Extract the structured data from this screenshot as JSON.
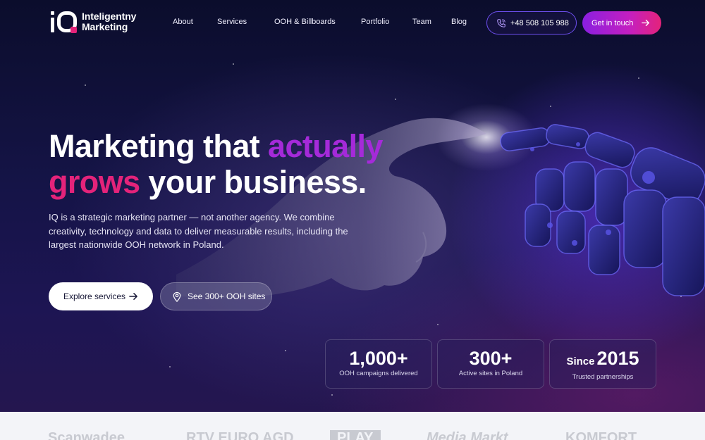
{
  "brand": {
    "line1": "Inteligentny",
    "line2": "Marketing"
  },
  "nav": {
    "links": [
      "About",
      "Services",
      "OOH & Billboards",
      "Portfolio",
      "Team",
      "Blog"
    ],
    "phone": "+48 508 105 988",
    "cta": "Get in touch"
  },
  "hero": {
    "headline": {
      "part1": "Marketing that ",
      "part2": "actually",
      "part3": "grows",
      "part4": " your business."
    },
    "lead": "IQ is a strategic marketing partner — not another agency. We combine creativity, technology and data to deliver measurable results, including the largest nationwide OOH network in Poland.",
    "primary_button": "Explore services",
    "secondary_button": "See 300+ OOH sites"
  },
  "stats": [
    {
      "prefix": "",
      "value": "1,000+",
      "label": "OOH campaigns delivered"
    },
    {
      "prefix": "",
      "value": "300+",
      "label": "Active sites in Poland"
    },
    {
      "prefix": "Since",
      "value": "2015",
      "label": "Trusted partnerships"
    }
  ],
  "partners": [
    "Scanwadee",
    "RTV EURO AGD",
    "PLAY",
    "Media Markt",
    "KOMFORT"
  ],
  "colors": {
    "accent_purple": "#a52ad9",
    "accent_pink": "#e4237a",
    "background": "#0c0f2e"
  },
  "icons": {
    "phone": "phone-icon",
    "arrow": "arrow-right-icon",
    "pin": "map-pin-icon"
  }
}
